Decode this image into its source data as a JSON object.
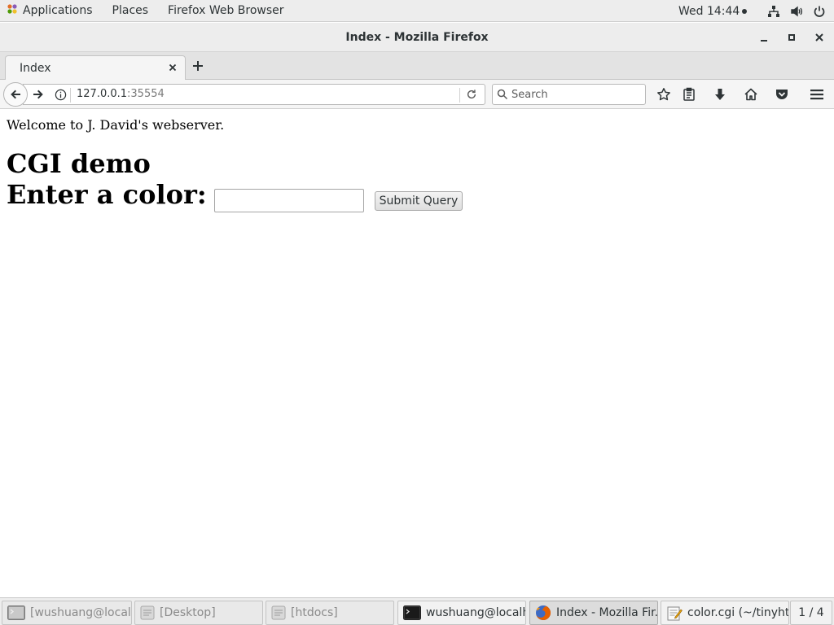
{
  "top_panel": {
    "applications_label": "Applications",
    "places_label": "Places",
    "active_app_label": "Firefox Web Browser",
    "clock": "Wed 14:44"
  },
  "window": {
    "title": "Index - Mozilla Firefox"
  },
  "tabs": [
    {
      "label": "Index"
    }
  ],
  "navbar": {
    "url_host": "127.0.0.1",
    "url_port": ":35554",
    "search_placeholder": "Search"
  },
  "page": {
    "welcome_text": "Welcome to J. David's webserver.",
    "heading": "CGI demo",
    "prompt": "Enter a color:",
    "color_input_value": "",
    "submit_label": "Submit Query"
  },
  "taskbar": {
    "tasks": [
      {
        "label": "[wushuang@localh...",
        "state": "minimized",
        "icon": "terminal-icon"
      },
      {
        "label": "[Desktop]",
        "state": "minimized",
        "icon": "file-manager-icon"
      },
      {
        "label": "[htdocs]",
        "state": "minimized",
        "icon": "file-manager-icon"
      },
      {
        "label": "wushuang@localh...",
        "state": "normal",
        "icon": "terminal-icon"
      },
      {
        "label": "Index - Mozilla Fir...",
        "state": "active",
        "icon": "firefox-icon"
      },
      {
        "label": "color.cgi (~/tinyhtt...",
        "state": "normal",
        "icon": "text-editor-icon"
      }
    ],
    "workspace_indicator": "1 / 4"
  }
}
